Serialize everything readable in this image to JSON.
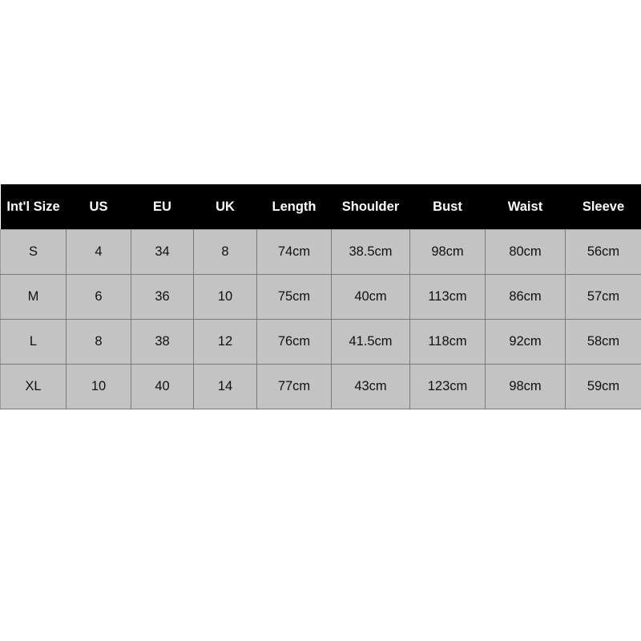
{
  "chart_data": {
    "type": "table",
    "title": "",
    "columns": [
      "Int'l Size",
      "US",
      "EU",
      "UK",
      "Length",
      "Shoulder",
      "Bust",
      "Waist",
      "Sleeve"
    ],
    "rows": [
      [
        "S",
        "4",
        "34",
        "8",
        "74cm",
        "38.5cm",
        "98cm",
        "80cm",
        "56cm"
      ],
      [
        "M",
        "6",
        "36",
        "10",
        "75cm",
        "40cm",
        "113cm",
        "86cm",
        "57cm"
      ],
      [
        "L",
        "8",
        "38",
        "12",
        "76cm",
        "41.5cm",
        "118cm",
        "92cm",
        "58cm"
      ],
      [
        "XL",
        "10",
        "40",
        "14",
        "77cm",
        "43cm",
        "123cm",
        "98cm",
        "59cm"
      ]
    ],
    "colors": {
      "header_background": "#000000",
      "header_text": "#ffffff",
      "cell_background": "#c3c3c3",
      "cell_text": "#111111",
      "cell_border": "#7a7a7a",
      "page_background": "#ffffff"
    }
  }
}
